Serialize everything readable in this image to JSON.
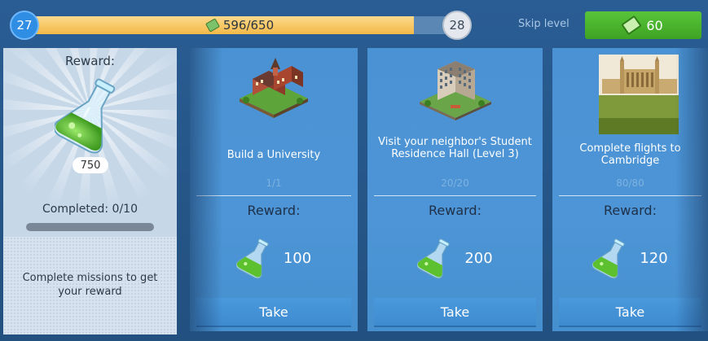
{
  "level": {
    "current": "27",
    "next": "28",
    "xp_text": "596/650",
    "xp_fraction": 0.917
  },
  "skip": {
    "label": "Skip level",
    "cost": "60",
    "button_color": "#46b12a"
  },
  "reward_panel": {
    "title": "Reward:",
    "amount": "750",
    "completed_text": "Completed: 0/10",
    "hint": "Complete missions to get your reward"
  },
  "missions": [
    {
      "title": "Build a University",
      "progress": "1/1",
      "reward_label": "Reward:",
      "reward_value": "100",
      "take_label": "Take",
      "art_icon": "university-building-icon"
    },
    {
      "title": "Visit your neighbor's Student Residence Hall (Level 3)",
      "progress": "20/20",
      "reward_label": "Reward:",
      "reward_value": "200",
      "take_label": "Take",
      "art_icon": "residence-hall-building-icon"
    },
    {
      "title": "Complete flights to Cambridge",
      "progress": "80/80",
      "reward_label": "Reward:",
      "reward_value": "120",
      "take_label": "Take",
      "art_icon": "cambridge-photo"
    }
  ],
  "colors": {
    "background": "#2a5d94",
    "card": "#4a92d3",
    "xp_fill": "#f3b948",
    "flask_green": "#5dc12f"
  }
}
